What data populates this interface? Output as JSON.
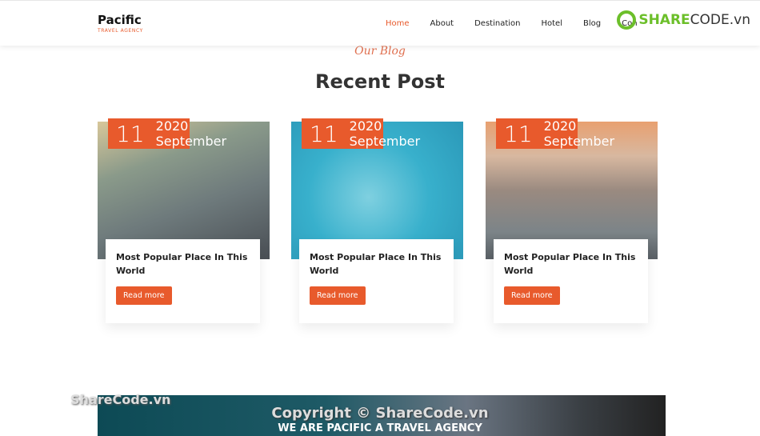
{
  "nav": {
    "brand": "Pacific",
    "tagline": "TRAVEL AGENCY",
    "items": [
      "Home",
      "About",
      "Destination",
      "Hotel",
      "Blog",
      "Con"
    ],
    "active": "Home"
  },
  "watermark": {
    "logo_green": "SHARE",
    "logo_dark": "CODE.vn",
    "text": "ShareCode.vn"
  },
  "section": {
    "subtitle": "Our Blog",
    "title": "Recent Post"
  },
  "posts": [
    {
      "day": "11",
      "year": "2020",
      "month": "September",
      "title": "Most Popular Place In This World",
      "button": "Read more"
    },
    {
      "day": "11",
      "year": "2020",
      "month": "September",
      "title": "Most Popular Place In This World",
      "button": "Read more"
    },
    {
      "day": "11",
      "year": "2020",
      "month": "September",
      "title": "Most Popular Place In This World",
      "button": "Read more"
    }
  ],
  "footer": {
    "copyright": "Copyright © ShareCode.vn",
    "banner": "WE ARE PACIFIC A TRAVEL AGENCY"
  },
  "colors": {
    "accent": "#e85a2c"
  }
}
